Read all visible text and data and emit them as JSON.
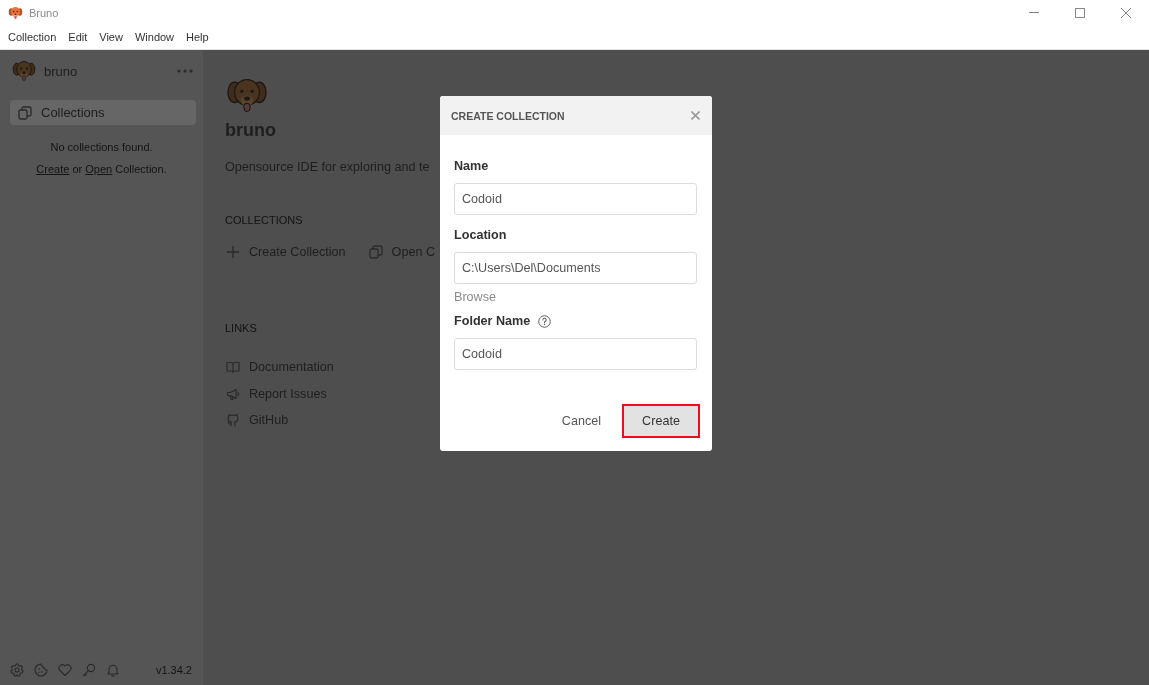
{
  "window": {
    "title": "Bruno"
  },
  "menu": [
    "Collection",
    "Edit",
    "View",
    "Window",
    "Help"
  ],
  "sidebar": {
    "brand": "bruno",
    "nav": [
      {
        "label": "Collections",
        "selected": true
      }
    ],
    "empty": {
      "message": "No collections found.",
      "hint": [
        {
          "text": "Create",
          "link": true
        },
        {
          "text": "or",
          "link": false
        },
        {
          "text": "Open",
          "link": true
        },
        {
          "text": "Collection.",
          "link": false
        }
      ]
    },
    "version": "v1.34.2"
  },
  "main": {
    "brand": "bruno",
    "tagline": "Opensource IDE for exploring and te",
    "collections": {
      "heading": "COLLECTIONS",
      "actions": [
        {
          "kind": "create",
          "label": "Create Collection"
        },
        {
          "kind": "open",
          "label": "Open C"
        }
      ]
    },
    "links": {
      "heading": "LINKS",
      "items": [
        {
          "kind": "docs",
          "label": "Documentation"
        },
        {
          "kind": "issues",
          "label": "Report Issues"
        },
        {
          "kind": "github",
          "label": "GitHub"
        }
      ]
    }
  },
  "dialog": {
    "title": "CREATE COLLECTION",
    "fields": [
      {
        "label": "Name",
        "value": "Codoid",
        "help": false
      },
      {
        "label": "Location",
        "value": "C:\\Users\\Del\\Documents",
        "help": false,
        "action": "Browse"
      },
      {
        "label": "Folder Name",
        "value": "Codoid",
        "help": true
      }
    ],
    "buttons": [
      {
        "label": "Cancel",
        "kind": "secondary",
        "highlighted": false
      },
      {
        "label": "Create",
        "kind": "primary",
        "highlighted": true
      }
    ]
  }
}
